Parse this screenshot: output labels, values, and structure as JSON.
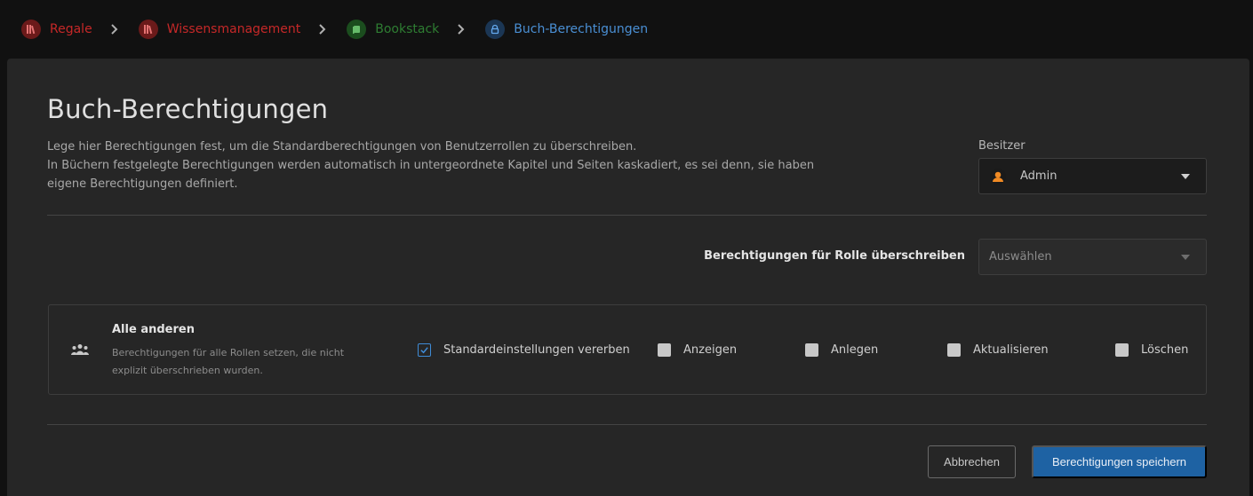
{
  "breadcrumbs": [
    {
      "label": "Regale",
      "color": "#c62828",
      "icon": "shelves-icon",
      "icon_bg": "#6b1a1a"
    },
    {
      "label": "Wissensmanagement",
      "color": "#c62828",
      "icon": "shelves-icon",
      "icon_bg": "#6b1a1a"
    },
    {
      "label": "Bookstack",
      "color": "#2e7d32",
      "icon": "book-icon",
      "icon_bg": "#1b4d1e"
    },
    {
      "label": "Buch-Berechtigungen",
      "color": "#4a8fd4",
      "icon": "lock-icon",
      "icon_bg": "#1b3654"
    }
  ],
  "page": {
    "title": "Buch-Berechtigungen",
    "description_line1": "Lege hier Berechtigungen fest, um die Standardberechtigungen von Benutzerrollen zu überschreiben.",
    "description_line2": "In Büchern festgelegte Berechtigungen werden automatisch in untergeordnete Kapitel und Seiten kaskadiert, es sei denn, sie haben eigene Berechtigungen definiert."
  },
  "owner": {
    "label": "Besitzer",
    "value": "Admin"
  },
  "role_override": {
    "label": "Berechtigungen für Rolle überschreiben",
    "placeholder": "Auswählen"
  },
  "everyone": {
    "title": "Alle anderen",
    "subtitle": "Berechtigungen für alle Rollen setzen, die nicht explizit überschrieben wurden.",
    "options": [
      {
        "label": "Standardeinstellungen vererben",
        "checked": true
      },
      {
        "label": "Anzeigen",
        "checked": false
      },
      {
        "label": "Anlegen",
        "checked": false
      },
      {
        "label": "Aktualisieren",
        "checked": false
      },
      {
        "label": "Löschen",
        "checked": false
      }
    ]
  },
  "actions": {
    "cancel_label": "Abbrechen",
    "save_label": "Berechtigungen speichern"
  },
  "colors": {
    "accent": "#1e62a3",
    "checkbox_checked": "#3f8bd6"
  }
}
